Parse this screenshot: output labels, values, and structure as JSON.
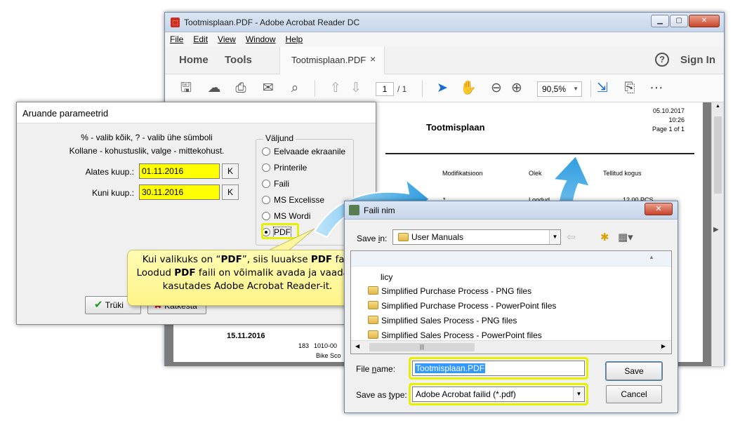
{
  "acrobat": {
    "title": "Tootmisplaan.PDF - Adobe Acrobat Reader DC",
    "menu": [
      "File",
      "Edit",
      "View",
      "Window",
      "Help"
    ],
    "tabs": {
      "home": "Home",
      "tools": "Tools",
      "document": "Tootmisplaan.PDF",
      "close": "×"
    },
    "help": "?",
    "sign_in": "Sign In",
    "toolbar": {
      "page_current": "1",
      "page_total": "/ 1",
      "zoom": "90,5%"
    },
    "document": {
      "title": "Tootmisplaan",
      "date": "05.10.2017",
      "time": "10:26",
      "page": "Page 1 of 1",
      "columns": [
        "Modifikatsioon",
        "Olek",
        "Tellitud kogus"
      ],
      "row_asterisk": "*",
      "row_status": "Loodud",
      "row_qty": "12,00 PCS",
      "row_date": "15.11.2016",
      "row_number": "183",
      "row_code": "1010-00",
      "row_name": "Bike Sco"
    }
  },
  "params": {
    "title": "Aruande parameetrid",
    "hint1": "% - valib kõik, ? - valib ühe sümboli",
    "hint2": "Kollane - kohustuslik, valge - mittekohust.",
    "from_label": "Alates kuup.:",
    "from_value": "01.11.2016",
    "to_label": "Kuni kuup.:",
    "to_value": "30.11.2016",
    "k_label": "K",
    "output_group": "Väljund",
    "options": [
      "Eelvaade ekraanile",
      "Printerile",
      "Faili",
      "MS Excelisse",
      "MS Wordi",
      "PDF"
    ],
    "selected_option": "PDF",
    "print_button": "Trüki",
    "cancel_button": "Katkesta"
  },
  "callout": {
    "line1_pre": "Kui valikuks on “",
    "line1_bold": "PDF",
    "line1_post": "”, siis luuakse ",
    "line1_bold2": "PDF",
    "line1_end": " fail.",
    "line2_pre": "Loodud ",
    "line2_bold": "PDF",
    "line2_post": " faili on võimalik avada ja vaadata",
    "line3": "kasutades Adobe Acrobat Reader-it."
  },
  "save_dialog": {
    "title": "Faili nim",
    "close": "✕",
    "save_in_label": "Save in:",
    "save_in_value": "User Manuals",
    "items": [
      "licy",
      "Simplified Purchase Process - PNG files",
      "Simplified Purchase Process - PowerPoint files",
      "Simplified Sales Process - PNG files",
      "Simplified Sales Process - PowerPoint files"
    ],
    "file_name_label": "File name:",
    "file_name_value": "Tootmisplaan.PDF",
    "save_as_label": "Save as type:",
    "save_as_value": "Adobe Acrobat failid (*.pdf)",
    "save_button": "Save",
    "cancel_button": "Cancel"
  },
  "colors": {
    "required_field": "#ffff00",
    "highlight": "#e6f000",
    "arrow": "#3aa5e6",
    "callout": "#fff48a"
  }
}
